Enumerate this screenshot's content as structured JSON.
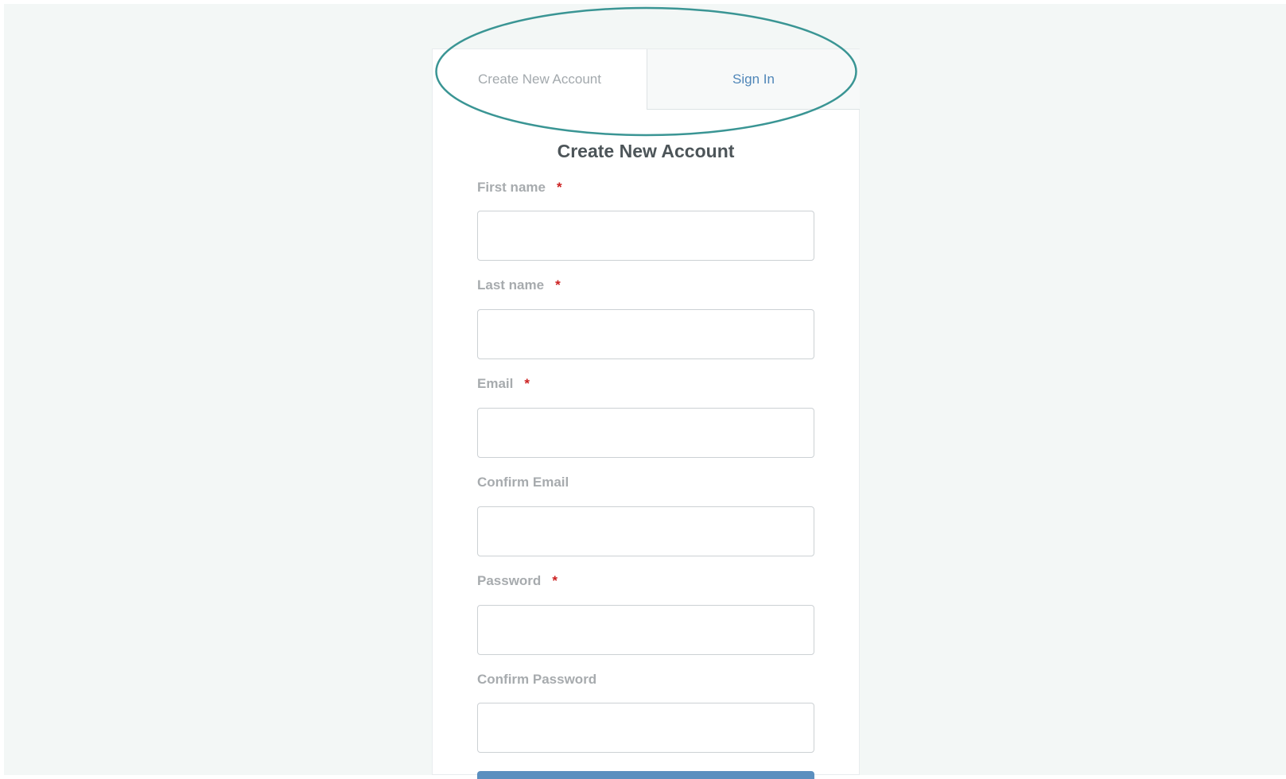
{
  "tabs": {
    "create_account": "Create New Account",
    "sign_in": "Sign In"
  },
  "form": {
    "title": "Create New Account",
    "required_marker": "*",
    "fields": [
      {
        "label": "First name",
        "required": true,
        "value": ""
      },
      {
        "label": "Last name",
        "required": true,
        "value": ""
      },
      {
        "label": "Email",
        "required": true,
        "value": ""
      },
      {
        "label": "Confirm Email",
        "required": false,
        "value": ""
      },
      {
        "label": "Password",
        "required": true,
        "value": ""
      },
      {
        "label": "Confirm Password",
        "required": false,
        "value": ""
      }
    ]
  },
  "colors": {
    "page_background": "#f3f7f6",
    "card_background": "#ffffff",
    "active_tab_text": "#a3a9ad",
    "inactive_tab_text": "#4f86b8",
    "label_text": "#a7abae",
    "required_marker": "#cc2020",
    "title_text": "#4d5559",
    "annotation_outline": "#3a9594",
    "submit_button": "#5b8fbf"
  }
}
